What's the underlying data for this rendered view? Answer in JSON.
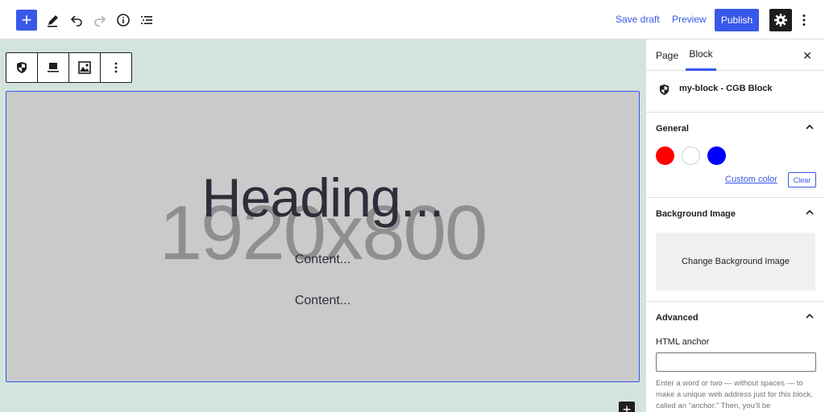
{
  "topbar": {
    "inserter_symbol": "+",
    "tools": [
      {
        "icon": "pencil-icon"
      },
      {
        "icon": "undo-icon"
      },
      {
        "icon": "redo-icon"
      },
      {
        "icon": "info-icon"
      },
      {
        "icon": "list-view-icon"
      }
    ],
    "save_draft": "Save draft",
    "preview": "Preview",
    "publish": "Publish",
    "settings_icon": "gear-icon",
    "more_icon": "vertical-ellipsis-icon",
    "accent_color": "#3858e9"
  },
  "canvas": {
    "background": "#d3e4dc",
    "block_toolbar": [
      "shield-icon",
      "align-icon",
      "image-icon",
      "vertical-ellipsis-icon"
    ],
    "block": {
      "placeholder": "1920x800",
      "heading": "Heading...",
      "content_1": "Content...",
      "content_2": "Content..."
    },
    "add_block_symbol": "+"
  },
  "sidebar": {
    "tabs": [
      "Page",
      "Block"
    ],
    "active_tab": "Block",
    "close_symbol": "✕",
    "block_card": {
      "icon": "shield-icon",
      "title": "my-block - CGB Block"
    },
    "general": {
      "title": "General",
      "swatches": [
        "#ff0000",
        "#ffffff",
        "#0000ff"
      ],
      "custom_color": "Custom color",
      "clear": "Clear"
    },
    "background_image": {
      "title": "Background Image",
      "button": "Change Background Image"
    },
    "advanced": {
      "title": "Advanced",
      "anchor_label": "HTML anchor",
      "anchor_value": "",
      "help": "Enter a word or two — without spaces — to make a unique web address just for this block, called an “anchor.” Then, you’ll be"
    }
  }
}
